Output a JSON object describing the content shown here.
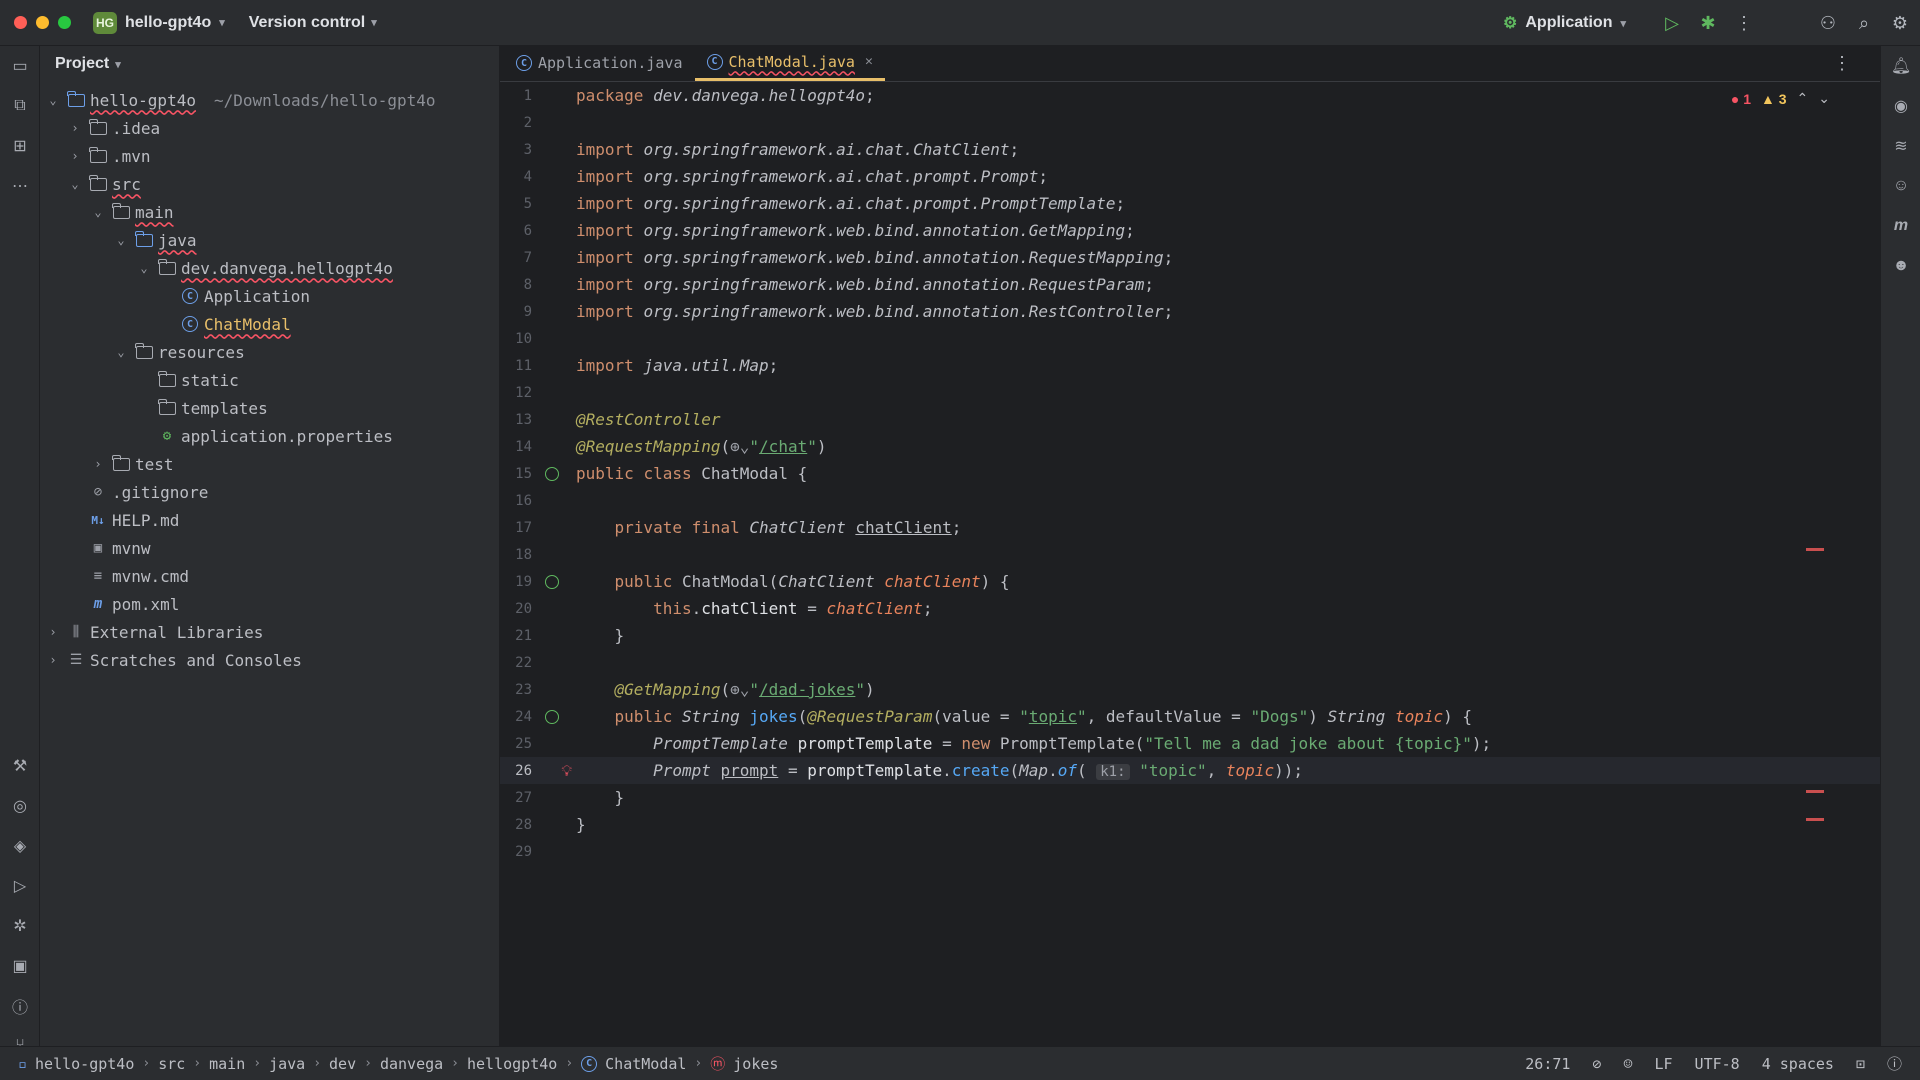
{
  "titlebar": {
    "project_badge": "HG",
    "project_name": "hello-gpt4o",
    "version_control": "Version control",
    "run_config": "Application"
  },
  "project_panel": {
    "title": "Project",
    "tree": [
      {
        "label": "hello-gpt4o",
        "path": "~/Downloads/hello-gpt4o"
      },
      {
        "label": ".idea"
      },
      {
        "label": ".mvn"
      },
      {
        "label": "src"
      },
      {
        "label": "main"
      },
      {
        "label": "java"
      },
      {
        "label": "dev.danvega.hellogpt4o"
      },
      {
        "label": "Application"
      },
      {
        "label": "ChatModal"
      },
      {
        "label": "resources"
      },
      {
        "label": "static"
      },
      {
        "label": "templates"
      },
      {
        "label": "application.properties"
      },
      {
        "label": "test"
      },
      {
        "label": ".gitignore"
      },
      {
        "label": "HELP.md"
      },
      {
        "label": "mvnw"
      },
      {
        "label": "mvnw.cmd"
      },
      {
        "label": "pom.xml"
      },
      {
        "label": "External Libraries"
      },
      {
        "label": "Scratches and Consoles"
      }
    ]
  },
  "tabs": [
    {
      "label": "Application.java"
    },
    {
      "label": "ChatModal.java"
    }
  ],
  "inspections": {
    "errors": "1",
    "warnings": "3"
  },
  "code": {
    "l1_kw": "package",
    "l1_pkg": "dev.danvega.hellogpt4o",
    "import_kw": "import",
    "imp3": "org.springframework.ai.chat.ChatClient",
    "imp4": "org.springframework.ai.chat.prompt.Prompt",
    "imp5": "org.springframework.ai.chat.prompt.PromptTemplate",
    "imp6": "org.springframework.web.bind.annotation.GetMapping",
    "imp7": "org.springframework.web.bind.annotation.RequestMapping",
    "imp8": "org.springframework.web.bind.annotation.RequestParam",
    "imp9": "org.springframework.web.bind.annotation.RestController",
    "imp11": "java.util.Map",
    "ann13": "@RestController",
    "ann14": "@RequestMapping",
    "path14": "/chat",
    "public_kw": "public",
    "class_kw": "class",
    "class_name": "ChatModal",
    "private_kw": "private",
    "final_kw": "final",
    "chatclient_type": "ChatClient",
    "chatclient_field": "chatClient",
    "ctor_name": "ChatModal",
    "ctor_param": "chatClient",
    "this_kw": "this",
    "ann23": "@GetMapping",
    "path23": "/dad-jokes",
    "string_type": "String",
    "jokes_fn": "jokes",
    "reqparam_ann": "@RequestParam",
    "value_attr": "value",
    "topic_str": "topic",
    "default_attr": "defaultValue",
    "dogs_str": "\"Dogs\"",
    "topic_param": "topic",
    "pt_type": "PromptTemplate",
    "pt_var": "promptTemplate",
    "new_kw": "new",
    "pt_str": "\"Tell me a dad joke about {topic}\"",
    "prompt_type": "Prompt",
    "prompt_var": "prompt",
    "create_fn": "create",
    "map_cls": "Map",
    "of_fn": "of",
    "hint_k1": "k1:",
    "topic_lit": "\"topic\""
  },
  "line_numbers": [
    "1",
    "2",
    "3",
    "4",
    "5",
    "6",
    "7",
    "8",
    "9",
    "10",
    "11",
    "12",
    "13",
    "14",
    "15",
    "16",
    "17",
    "18",
    "19",
    "20",
    "21",
    "22",
    "23",
    "24",
    "25",
    "26",
    "27",
    "28",
    "29"
  ],
  "statusbar": {
    "crumbs": [
      "hello-gpt4o",
      "src",
      "main",
      "java",
      "dev",
      "danvega",
      "hellogpt4o",
      "ChatModal",
      "jokes"
    ],
    "position": "26:71",
    "line_sep": "LF",
    "encoding": "UTF-8",
    "indent": "4 spaces"
  }
}
